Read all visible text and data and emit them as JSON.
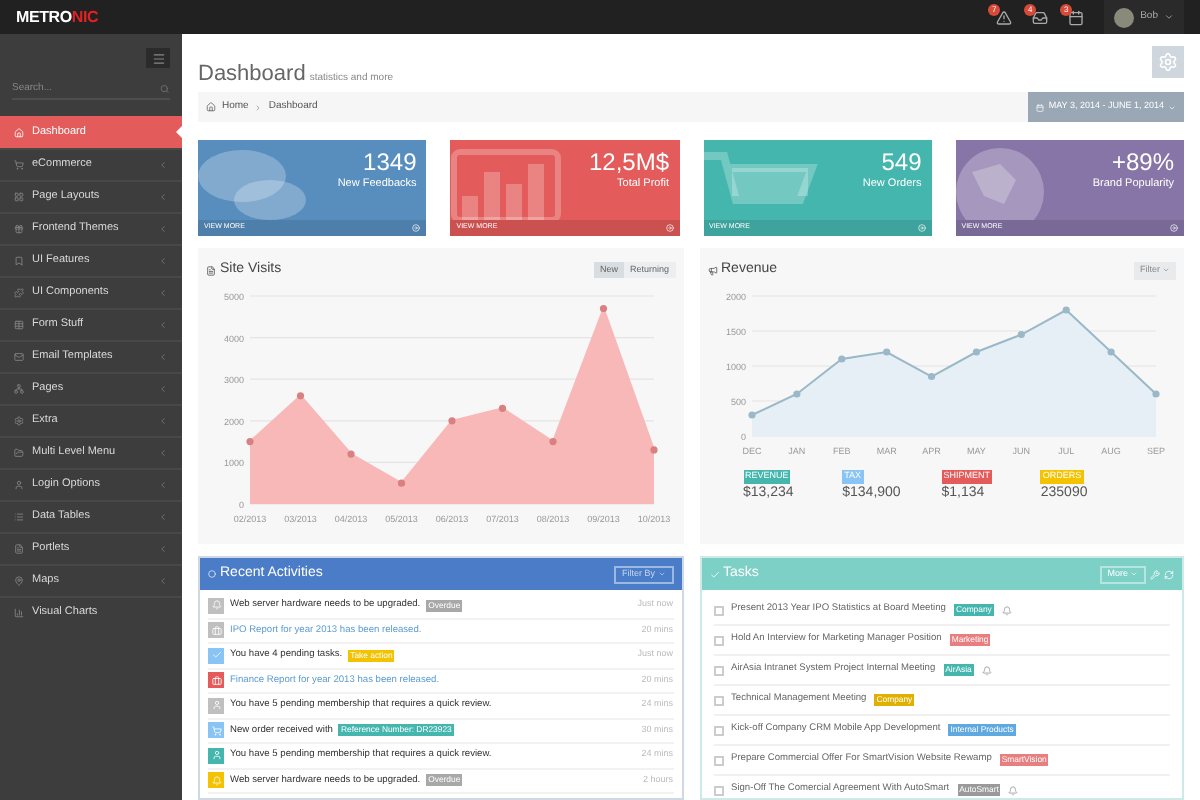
{
  "header": {
    "logo": {
      "main": "METRO",
      "accent": "NIC"
    },
    "notifications": [
      {
        "count": "7"
      },
      {
        "count": "4"
      },
      {
        "count": "3"
      }
    ],
    "user": {
      "name": "Bob"
    }
  },
  "sidebar": {
    "search": {
      "placeholder": "Search..."
    },
    "items": [
      {
        "label": "Dashboard",
        "selected": true,
        "submenu": false
      },
      {
        "label": "eCommerce",
        "selected": false,
        "submenu": true
      },
      {
        "label": "Page Layouts",
        "selected": false,
        "submenu": true
      },
      {
        "label": "Frontend Themes",
        "selected": false,
        "submenu": true
      },
      {
        "label": "UI Features",
        "selected": false,
        "submenu": true
      },
      {
        "label": "UI Components",
        "selected": false,
        "submenu": true
      },
      {
        "label": "Form Stuff",
        "selected": false,
        "submenu": true
      },
      {
        "label": "Email Templates",
        "selected": false,
        "submenu": true
      },
      {
        "label": "Pages",
        "selected": false,
        "submenu": true
      },
      {
        "label": "Extra",
        "selected": false,
        "submenu": true
      },
      {
        "label": "Multi Level Menu",
        "selected": false,
        "submenu": true
      },
      {
        "label": "Login Options",
        "selected": false,
        "submenu": true
      },
      {
        "label": "Data Tables",
        "selected": false,
        "submenu": true
      },
      {
        "label": "Portlets",
        "selected": false,
        "submenu": true
      },
      {
        "label": "Maps",
        "selected": false,
        "submenu": true
      },
      {
        "label": "Visual Charts",
        "selected": false,
        "submenu": false
      }
    ]
  },
  "page": {
    "title": "Dashboard",
    "subtitle": "statistics and more",
    "breadcrumb": [
      "Home",
      "Dashboard"
    ],
    "date_range": "MAY 3, 2014 - JUNE 1, 2014"
  },
  "stats": [
    {
      "value": "1349",
      "label": "New Feedbacks",
      "link": "VIEW MORE",
      "color": "#578ebe"
    },
    {
      "value": "12,5M$",
      "label": "Total Profit",
      "link": "VIEW MORE",
      "color": "#e35b5a"
    },
    {
      "value": "549",
      "label": "New Orders",
      "link": "VIEW MORE",
      "color": "#44b6ae"
    },
    {
      "value": "+89%",
      "label": "Brand Popularity",
      "link": "VIEW MORE",
      "color": "#8775a7"
    }
  ],
  "site_visits": {
    "title": "Site Visits",
    "toggles": [
      {
        "label": "New",
        "selected": true
      },
      {
        "label": "Returning",
        "selected": false
      }
    ],
    "chart_data": {
      "type": "area",
      "grid": true,
      "categories": [
        "02/2013",
        "03/2013",
        "04/2013",
        "05/2013",
        "06/2013",
        "07/2013",
        "08/2013",
        "09/2013",
        "10/2013"
      ],
      "series": [
        {
          "color": "#f8b8b8",
          "values": [
            1500,
            2600,
            1200,
            500,
            2000,
            2300,
            1500,
            4700,
            1300
          ]
        }
      ],
      "ylim": [
        0,
        5000
      ],
      "yticks": [
        0,
        1000,
        2000,
        3000,
        4000,
        5000
      ]
    }
  },
  "revenue": {
    "title": "Revenue",
    "filter": "Filter",
    "chart_data": {
      "type": "area",
      "grid": true,
      "categories": [
        "DEC",
        "JAN",
        "FEB",
        "MAR",
        "APR",
        "MAY",
        "JUN",
        "JUL",
        "AUG",
        "SEP"
      ],
      "series": [
        {
          "color": "#9ab8c8",
          "values": [
            300,
            600,
            1100,
            1200,
            850,
            1200,
            1450,
            1800,
            1200,
            600
          ]
        }
      ],
      "ylim": [
        0,
        2000
      ],
      "yticks": [
        0,
        500,
        1000,
        1500,
        2000
      ]
    },
    "totals": [
      {
        "label": "REVENUE",
        "value": "$13,234",
        "color": "#44b6ae"
      },
      {
        "label": "TAX",
        "value": "$134,900",
        "color": "#89c4f4"
      },
      {
        "label": "SHIPMENT",
        "value": "$1,134",
        "color": "#e35b5a"
      },
      {
        "label": "ORDERS",
        "value": "235090",
        "color": "#f3c200"
      }
    ]
  },
  "activities": {
    "title": "Recent Activities",
    "filter": "Filter By",
    "items": [
      {
        "text": "Web server hardware needs to be upgraded.",
        "link": false,
        "badge": {
          "text": "Overdue",
          "color": "#a8a8a8"
        },
        "time": "Just now",
        "color": "#bfbfbf"
      },
      {
        "text": "IPO Report for year 2013 has been released.",
        "link": true,
        "time": "20 mins",
        "color": "#bfbfbf"
      },
      {
        "text": "You have 4 pending tasks.",
        "link": false,
        "badge": {
          "text": "Take action",
          "color": "#f3c200"
        },
        "time": "Just now",
        "color": "#89c4f4"
      },
      {
        "text": "Finance Report for year 2013 has been released.",
        "link": true,
        "time": "20 mins",
        "color": "#e35b5a"
      },
      {
        "text": "You have 5 pending membership that requires a quick review.",
        "link": false,
        "time": "24 mins",
        "color": "#bfbfbf"
      },
      {
        "text": "New order received with",
        "link": false,
        "badge": {
          "text": "Reference Number: DR23923",
          "color": "#44b6ae"
        },
        "time": "30 mins",
        "color": "#89c4f4"
      },
      {
        "text": "You have 5 pending membership that requires a quick review.",
        "link": false,
        "time": "24 mins",
        "color": "#44b6ae"
      },
      {
        "text": "Web server hardware needs to be upgraded.",
        "link": false,
        "badge": {
          "text": "Overdue",
          "color": "#a8a8a8"
        },
        "time": "2 hours",
        "color": "#f3c200"
      }
    ]
  },
  "tasks": {
    "title": "Tasks",
    "more": "More",
    "items": [
      {
        "text": "Present 2013 Year IPO Statistics at Board Meeting",
        "tag": {
          "text": "Company",
          "color": "#44b6ae"
        },
        "checked": false,
        "bell": true
      },
      {
        "text": "Hold An Interview for Marketing Manager Position",
        "tag": {
          "text": "Marketing",
          "color": "#e87e7e"
        },
        "checked": false,
        "bell": false
      },
      {
        "text": "AirAsia Intranet System Project Internal Meeting",
        "tag": {
          "text": "AirAsia",
          "color": "#44b6ae"
        },
        "checked": false,
        "bell": true
      },
      {
        "text": "Technical Management Meeting",
        "tag": {
          "text": "Company",
          "color": "#e0b000"
        },
        "checked": false,
        "bell": false
      },
      {
        "text": "Kick-off Company CRM Mobile App Development",
        "tag": {
          "text": "Internal Products",
          "color": "#5fa8e0"
        },
        "checked": false,
        "bell": false
      },
      {
        "text": "Prepare Commercial Offer For SmartVision Website Rewamp",
        "tag": {
          "text": "SmartVision",
          "color": "#e87e7e"
        },
        "checked": false,
        "bell": false
      },
      {
        "text": "Sign-Off The Comercial Agreement With AutoSmart",
        "tag": {
          "text": "AutoSmart",
          "color": "#9a9a9a"
        },
        "checked": false,
        "bell": true
      }
    ]
  }
}
